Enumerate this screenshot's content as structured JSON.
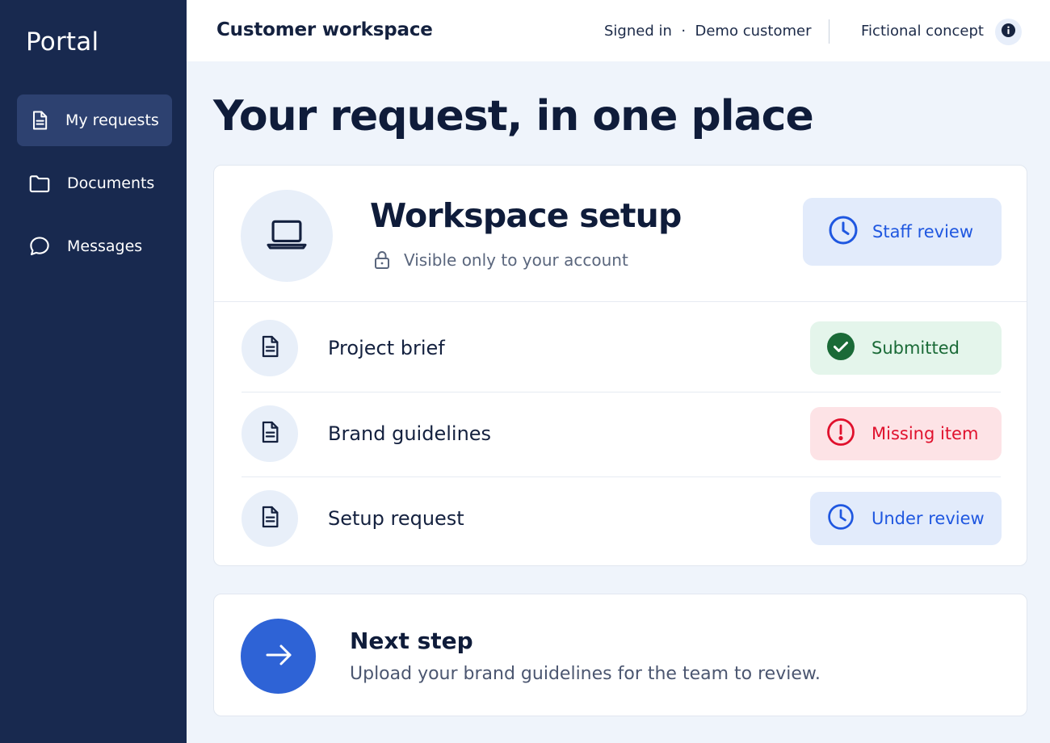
{
  "sidebar": {
    "brand": "Portal",
    "items": [
      {
        "label": "My requests",
        "icon": "document-icon",
        "active": true
      },
      {
        "label": "Documents",
        "icon": "folder-icon",
        "active": false
      },
      {
        "label": "Messages",
        "icon": "chat-bubble-icon",
        "active": false
      }
    ]
  },
  "header": {
    "title": "Customer workspace",
    "signed_in": "Signed in  ·  Demo customer",
    "concept": "Fictional concept",
    "info_icon": "info-icon"
  },
  "page": {
    "title": "Your request, in one place"
  },
  "request": {
    "icon": "laptop-icon",
    "title": "Workspace setup",
    "visibility": "Visible only to your account",
    "visibility_icon": "lock-icon",
    "status": {
      "label": "Staff review",
      "icon": "clock-icon"
    },
    "items": [
      {
        "name": "Project brief",
        "status": "Submitted",
        "status_icon": "check-circle-icon",
        "tone": "green"
      },
      {
        "name": "Brand guidelines",
        "status": "Missing item",
        "status_icon": "alert-circle-icon",
        "tone": "red"
      },
      {
        "name": "Setup request",
        "status": "Under review",
        "status_icon": "clock-icon",
        "tone": "blue"
      }
    ]
  },
  "next_step": {
    "title": "Next step",
    "description": "Upload your brand guidelines for the team to review.",
    "icon": "arrow-right-icon"
  },
  "colors": {
    "sidebar_bg": "#18294f",
    "sidebar_active": "#2d4170",
    "accent_blue": "#1f57e0",
    "success_green": "#1a6a37",
    "error_red": "#e0112d"
  }
}
